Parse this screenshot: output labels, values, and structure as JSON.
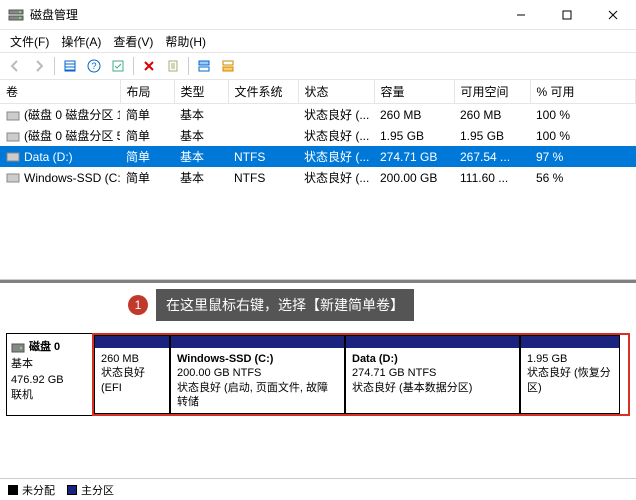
{
  "title": "磁盘管理",
  "menu": {
    "file": "文件(F)",
    "action": "操作(A)",
    "view": "查看(V)",
    "help": "帮助(H)"
  },
  "columns": {
    "vol": "卷",
    "layout": "布局",
    "type": "类型",
    "fs": "文件系统",
    "status": "状态",
    "cap": "容量",
    "free": "可用空间",
    "pct": "% 可用"
  },
  "volumes": [
    {
      "name": "(磁盘 0 磁盘分区 1)",
      "layout": "简单",
      "type": "基本",
      "fs": "",
      "status": "状态良好 (...",
      "cap": "260 MB",
      "free": "260 MB",
      "pct": "100 %",
      "selected": false
    },
    {
      "name": "(磁盘 0 磁盘分区 5)",
      "layout": "简单",
      "type": "基本",
      "fs": "",
      "status": "状态良好 (...",
      "cap": "1.95 GB",
      "free": "1.95 GB",
      "pct": "100 %",
      "selected": false
    },
    {
      "name": "Data (D:)",
      "layout": "简单",
      "type": "基本",
      "fs": "NTFS",
      "status": "状态良好 (...",
      "cap": "274.71 GB",
      "free": "267.54 ...",
      "pct": "97 %",
      "selected": true
    },
    {
      "name": "Windows-SSD (C:)",
      "layout": "简单",
      "type": "基本",
      "fs": "NTFS",
      "status": "状态良好 (...",
      "cap": "200.00 GB",
      "free": "111.60 ...",
      "pct": "56 %",
      "selected": false
    }
  ],
  "disk": {
    "label": "磁盘 0",
    "type": "基本",
    "size": "476.92 GB",
    "status": "联机",
    "parts": [
      {
        "title": "",
        "line1": "260 MB",
        "line2": "状态良好 (EFI ",
        "width": 76
      },
      {
        "title": "Windows-SSD  (C:)",
        "line1": "200.00 GB NTFS",
        "line2": "状态良好 (启动, 页面文件, 故障转储",
        "width": 175
      },
      {
        "title": "Data  (D:)",
        "line1": "274.71 GB NTFS",
        "line2": "状态良好 (基本数据分区)",
        "width": 175
      },
      {
        "title": "",
        "line1": "1.95 GB",
        "line2": "状态良好 (恢复分区)",
        "width": 100
      }
    ]
  },
  "annotation": {
    "num": "1",
    "text": "在这里鼠标右键，选择【新建简单卷】"
  },
  "legend": {
    "unalloc": "未分配",
    "primary": "主分区"
  }
}
